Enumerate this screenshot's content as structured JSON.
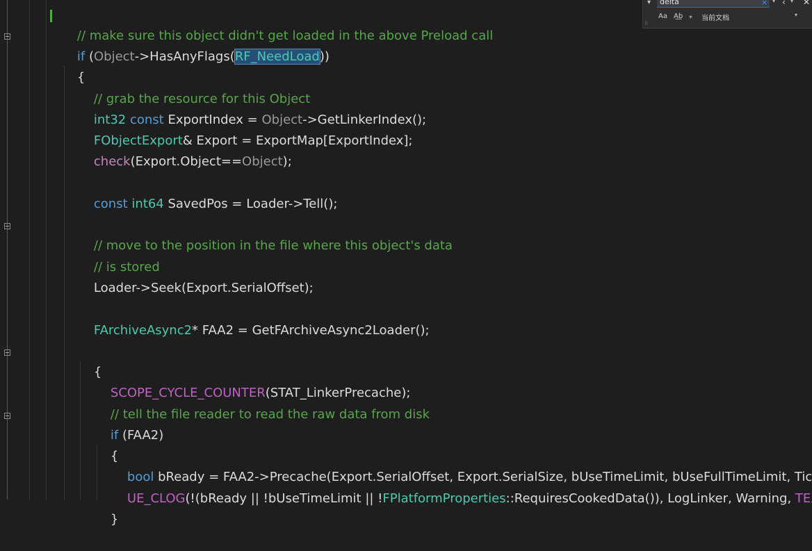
{
  "find_widget": {
    "query": "delta",
    "clear_icon": "×",
    "expand_icon": "▾",
    "prev_icon": "‹",
    "options_icon": "▾",
    "close_icon": "✕",
    "match_case": "Aa",
    "whole_word": "A͟b",
    "regex": "⁎",
    "scope": "当前文档",
    "scope_dropdown": "▾"
  },
  "code": {
    "l1_comment": "// make sure this object didn't get loaded in the above Preload call",
    "l2_if": "if",
    "l2_a": " (",
    "l2_obj": "Object",
    "l2_b": "->HasAnyFlags(",
    "l2_sel": "RF_NeedLoad",
    "l2_c": "))",
    "l3": "{",
    "l4_comment": "// grab the resource for this Object",
    "l5_int32": "int32",
    "l5_const": " const",
    "l5_a": " ExportIndex = ",
    "l5_obj": "Object",
    "l5_b": "->GetLinkerIndex();",
    "l6_type": "FObjectExport",
    "l6_a": "& Export = ExportMap[ExportIndex];",
    "l7_check": "check",
    "l7_a": "(Export.Object==",
    "l7_obj": "Object",
    "l7_b": ");",
    "l9_const": "const",
    "l9_int64": " int64",
    "l9_a": " SavedPos = Loader->Tell();",
    "l11_comment": "// move to the position in the file where this object's data",
    "l12_comment": "// is stored",
    "l13": "Loader->Seek(Export.SerialOffset);",
    "l15_type": "FArchiveAsync2",
    "l15_a": "* FAA2 = GetFArchiveAsync2Loader();",
    "l17": "{",
    "l18_macro": "SCOPE_CYCLE_COUNTER",
    "l18_a": "(STAT_LinkerPrecache);",
    "l19_comment": "// tell the file reader to read the raw data from disk",
    "l20_if": "if",
    "l20_a": " (FAA2)",
    "l21": "{",
    "l22_bool": "bool",
    "l22_a": " bReady = FAA2->Precache(Export.SerialOffset, Export.SerialSize, bUseTimeLimit, bUseFullTimeLimit, TickS",
    "l23_macro": "UE_CLOG",
    "l23_a": "(!(bReady || !bUseTimeLimit || !",
    "l23_type": "FPlatformProperties",
    "l23_b": "::RequiresCookedData()), LogLinker, Warning, ",
    "l23_text": "TEXT(",
    "l24": "}"
  }
}
